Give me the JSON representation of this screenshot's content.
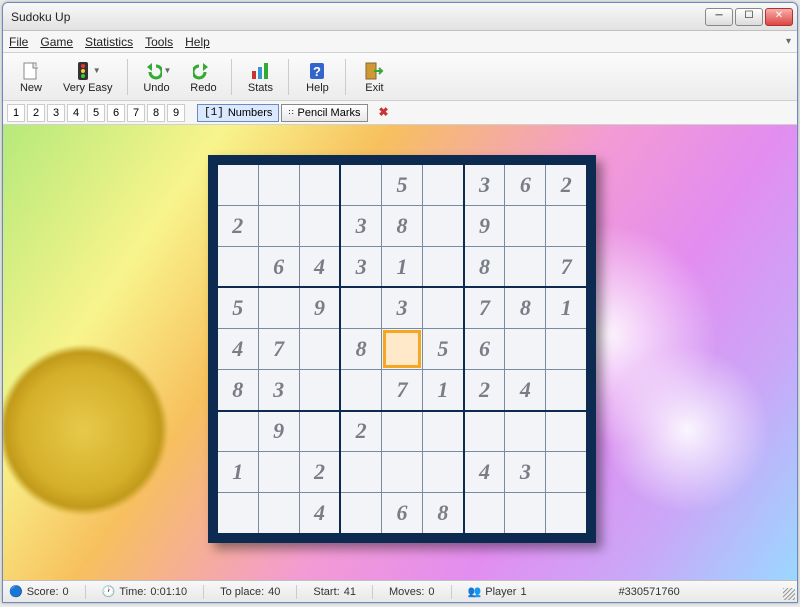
{
  "title": "Sudoku Up",
  "menus": [
    "File",
    "Game",
    "Statistics",
    "Tools",
    "Help"
  ],
  "toolbar": [
    {
      "name": "new-button",
      "label": "New",
      "icon": "new"
    },
    {
      "name": "difficulty-button",
      "label": "Very Easy",
      "icon": "traffic",
      "dd": true
    },
    {
      "sep": true
    },
    {
      "name": "undo-button",
      "label": "Undo",
      "icon": "undo",
      "dd": true
    },
    {
      "name": "redo-button",
      "label": "Redo",
      "icon": "redo"
    },
    {
      "sep": true
    },
    {
      "name": "stats-button",
      "label": "Stats",
      "icon": "stats"
    },
    {
      "sep": true
    },
    {
      "name": "help-button",
      "label": "Help",
      "icon": "help"
    },
    {
      "sep": true
    },
    {
      "name": "exit-button",
      "label": "Exit",
      "icon": "exit"
    }
  ],
  "numpad": [
    "1",
    "2",
    "3",
    "4",
    "5",
    "6",
    "7",
    "8",
    "9"
  ],
  "modes": {
    "numbers": "Numbers",
    "pencil": "Pencil Marks"
  },
  "board": [
    [
      "",
      "",
      "",
      "",
      "5",
      "",
      "3",
      "6",
      "2"
    ],
    [
      "2",
      "",
      "",
      "3",
      "8",
      "",
      "9",
      "",
      ""
    ],
    [
      "",
      "6",
      "4",
      "3",
      "1",
      "",
      "8",
      "",
      "7"
    ],
    [
      "5",
      "",
      "9",
      "",
      "3",
      "",
      "7",
      "8",
      "1"
    ],
    [
      "4",
      "7",
      "",
      "8",
      "",
      "5",
      "6",
      "",
      ""
    ],
    [
      "8",
      "3",
      "",
      "",
      "7",
      "1",
      "2",
      "4",
      ""
    ],
    [
      "",
      "9",
      "",
      "2",
      "",
      "",
      "",
      "",
      ""
    ],
    [
      "1",
      "",
      "2",
      "",
      "",
      "",
      "4",
      "3",
      ""
    ],
    [
      "",
      "",
      "4",
      "",
      "6",
      "8",
      "",
      "",
      ""
    ]
  ],
  "selected": {
    "r": 4,
    "c": 4
  },
  "status": {
    "score_label": "Score:",
    "score": "0",
    "time_label": "Time:",
    "time": "0:01:10",
    "toplace_label": "To place:",
    "toplace": "40",
    "start_label": "Start:",
    "start": "41",
    "moves_label": "Moves:",
    "moves": "0",
    "player_label": "Player",
    "player": "1",
    "puzzle_id": "#330571760"
  },
  "icons": {
    "new": "<svg width='20' height='20'><rect x='3' y='2' width='12' height='16' fill='#fff' stroke='#888'/><path d='M12 2v5h5' fill='#e0e0e0' stroke='#888'/></svg>",
    "traffic": "<svg width='16' height='20'><rect x='3' y='1' width='10' height='18' rx='2' fill='#333'/><circle cx='8' cy='5' r='2' fill='#e33'/><circle cx='8' cy='10' r='2' fill='#fc3'/><circle cx='8' cy='15' r='2' fill='#3c3'/></svg>",
    "undo": "<svg width='20' height='18'><path d='M14 4a6 6 0 1 1-6 6' fill='none' stroke='#3a3' stroke-width='3'/><path d='M10 1l-5 4 5 4z' fill='#3a3'/></svg>",
    "redo": "<svg width='20' height='18'><path d='M6 4a6 6 0 1 0 6 6' fill='none' stroke='#3a3' stroke-width='3'/><path d='M10 1l5 4-5 4z' fill='#3a3'/></svg>",
    "stats": "<svg width='20' height='20'><rect x='2' y='10' width='4' height='8' fill='#c33'/><rect x='8' y='6' width='4' height='12' fill='#39c'/><rect x='14' y='2' width='4' height='16' fill='#3a3'/></svg>",
    "help": "<svg width='18' height='20'><rect x='2' y='2' width='14' height='16' fill='#36c' rx='2'/><text x='9' y='15' text-anchor='middle' fill='#fff' font-size='13' font-weight='bold'>?</text></svg>",
    "exit": "<svg width='20' height='20'><rect x='2' y='2' width='10' height='16' fill='#c93' stroke='#863'/><path d='M10 10h8m-3-3l3 3-3 3' fill='none' stroke='#3a3' stroke-width='2'/></svg>"
  }
}
